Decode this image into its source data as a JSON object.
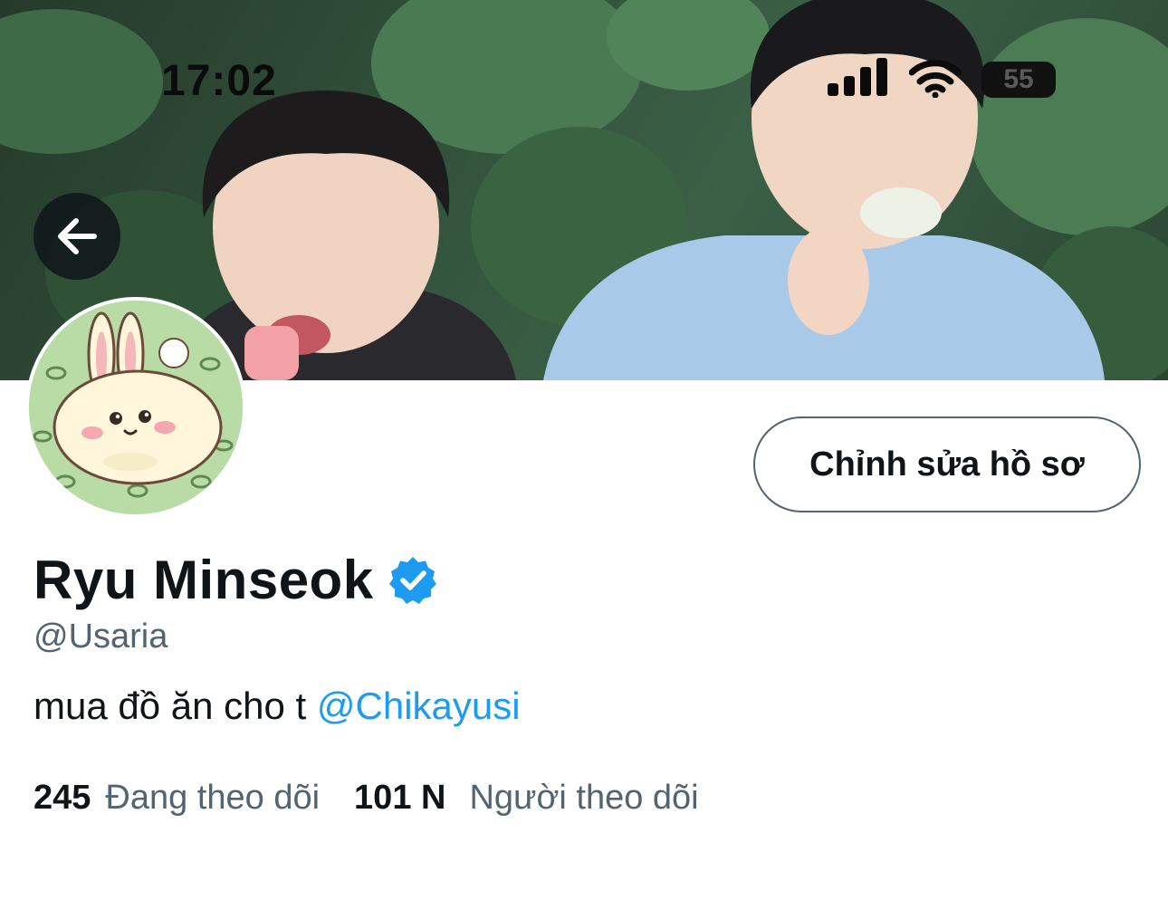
{
  "status_bar": {
    "time": "17:02",
    "battery": "55",
    "icons": [
      "signal-icon",
      "wifi-icon",
      "battery-icon"
    ]
  },
  "header": {
    "back_icon": "arrow-left-icon"
  },
  "profile": {
    "display_name": "Ryu Minseok",
    "verified": true,
    "handle": "@Usaria",
    "bio_text": "mua đồ ăn cho t ",
    "bio_mention": "@Chikayusi",
    "edit_button_label": "Chỉnh sửa hồ sơ",
    "following_count": "245",
    "following_label": "Đang theo dõi",
    "followers_count": "101 N",
    "followers_label": "Người theo dõi"
  },
  "colors": {
    "text_primary": "#0f1419",
    "text_secondary": "#536471",
    "accent": "#1d9bf0",
    "button_border": "#536471"
  }
}
